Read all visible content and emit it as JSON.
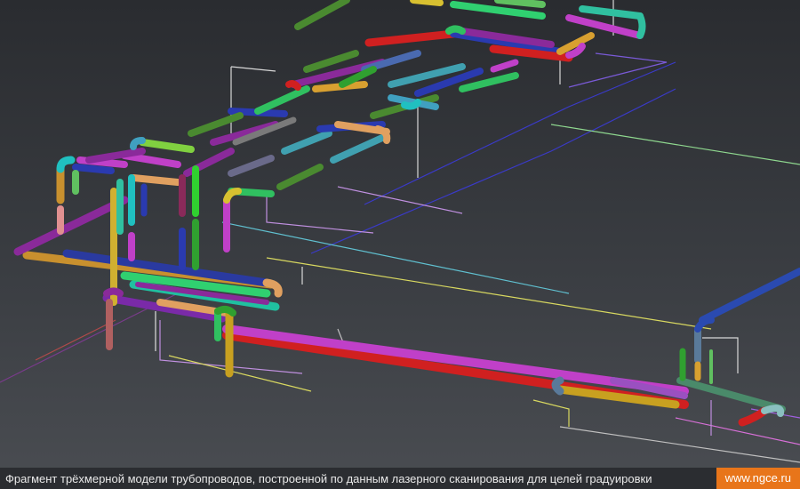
{
  "caption": "Фрагмент трёхмерной модели трубопроводов, построенной по данным лазерного сканирования для целей градуировки",
  "site": "www.ngce.ru",
  "colors": {
    "background_top": "#2a2c30",
    "background_bottom": "#4a4d52",
    "caption_bar": "#2b2d31",
    "badge": "#e8751a"
  }
}
